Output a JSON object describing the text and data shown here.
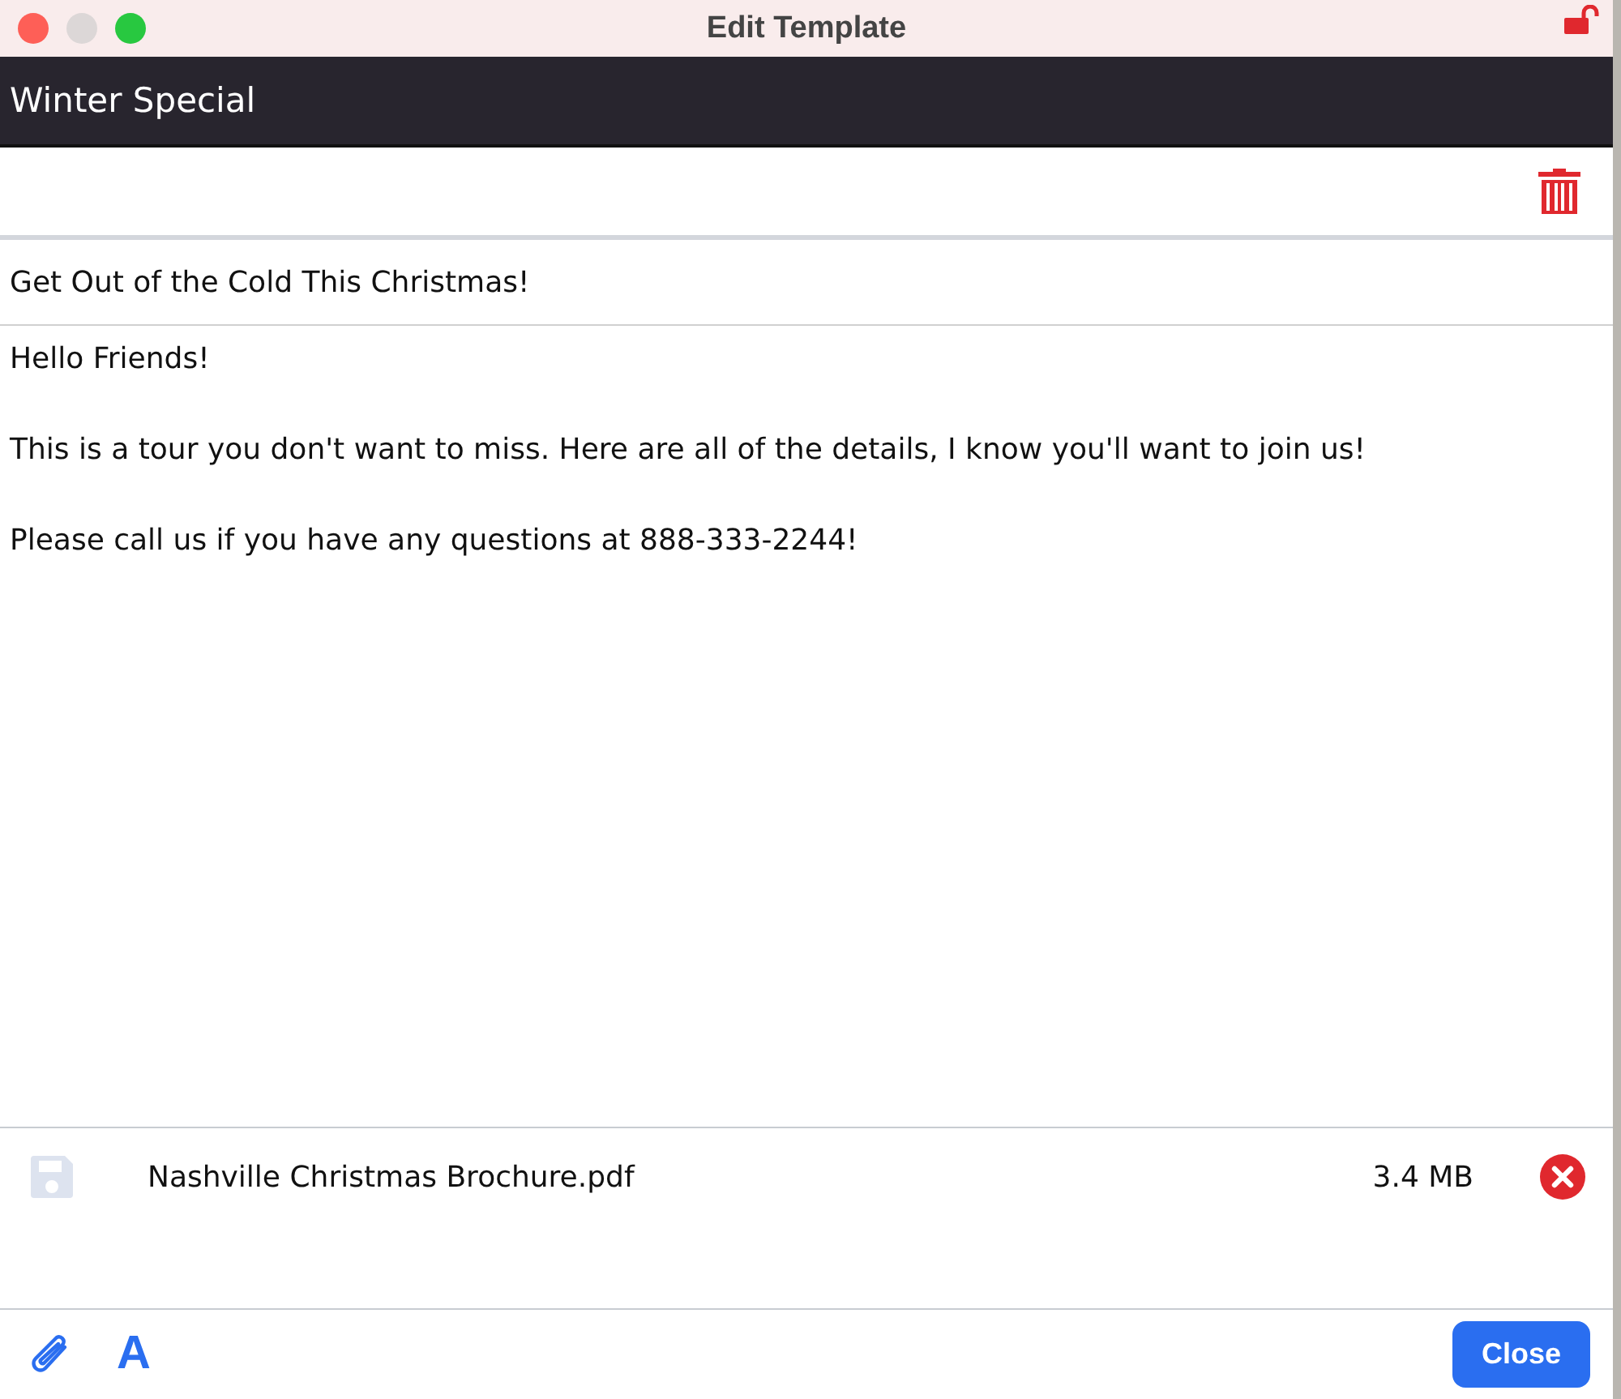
{
  "window": {
    "title": "Edit Template",
    "locked": false
  },
  "template_name": "Winter Special",
  "subject": "Get Out of the Cold This Christmas!",
  "body": [
    "Hello Friends!",
    "This is a tour you don't want to miss. Here are all of the details, I know you'll want to join us!",
    "Please call us if you have any questions at 888-333-2244!"
  ],
  "attachments": [
    {
      "name": "Nashville Christmas Brochure.pdf",
      "size": "3.4 MB"
    }
  ],
  "footer": {
    "format_button": "A",
    "close_button": "Close"
  }
}
